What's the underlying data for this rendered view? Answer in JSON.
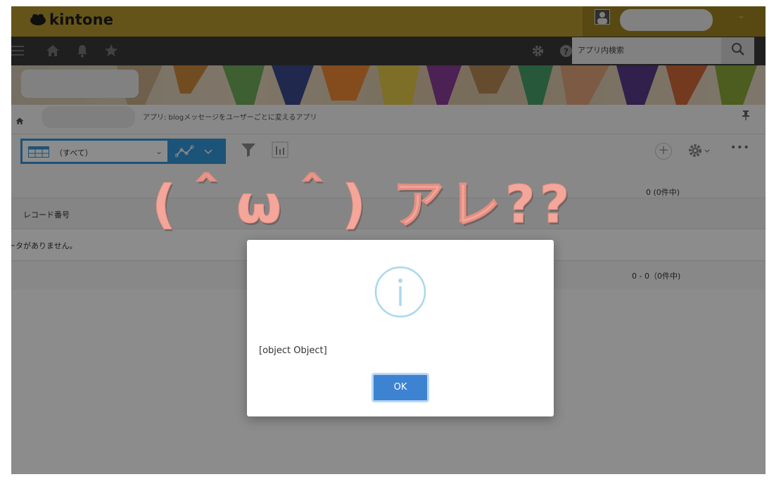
{
  "header": {
    "logo_text": "kintone",
    "user_name": ""
  },
  "nav": {
    "search_placeholder": "アプリ内検索"
  },
  "breadcrumb": {
    "space_name": "",
    "app_title": "アプリ: blogメッセージをユーザーごとに変えるアプリ"
  },
  "toolbar": {
    "view_label": "（すべて）",
    "pager_text": "0 (0件中)"
  },
  "table": {
    "columns": [
      "レコード番号"
    ],
    "empty_message": "データがありません。",
    "pager_text": "0 - 0（0件中)"
  },
  "overlay_text": "(＾ω＾) アレ??",
  "dialog": {
    "message": "[object Object]",
    "ok_label": "OK"
  },
  "colors": {
    "brand": "#b89a2e",
    "nav": "#3a3a3a",
    "accent": "#3498db",
    "ok_button": "#3d83d2",
    "emoticon": "#f4a69a"
  },
  "icons": [
    "menu-icon",
    "home-icon",
    "bell-icon",
    "star-icon",
    "gear-icon",
    "help-icon",
    "search-icon",
    "pin-icon",
    "grid-icon",
    "graph-icon",
    "filter-icon",
    "chart-icon",
    "plus-icon",
    "info-icon"
  ]
}
